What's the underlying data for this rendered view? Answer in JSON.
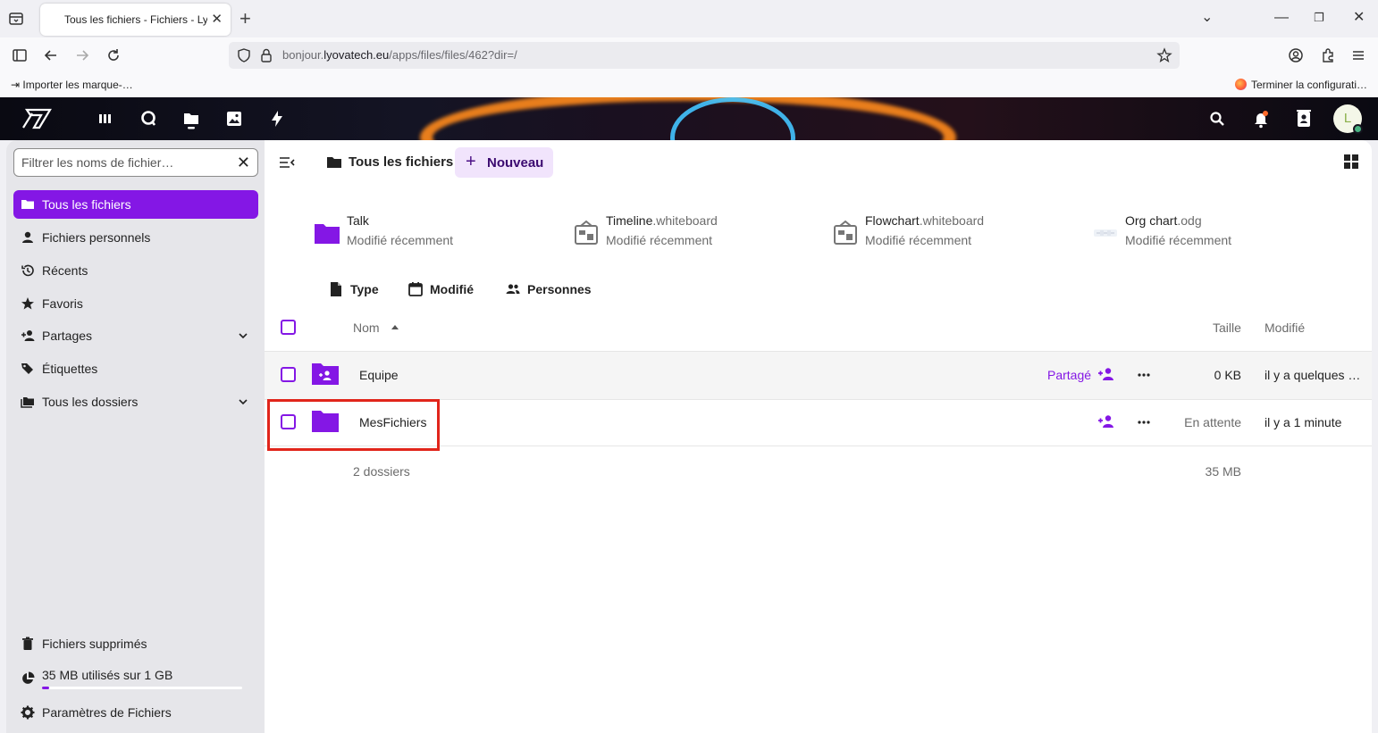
{
  "browser": {
    "tab_title": "Tous les fichiers - Fichiers - Lyov",
    "url_prefix": "bonjour.",
    "url_domain": "lyovatech.eu",
    "url_path": "/apps/files/files/462?dir=/",
    "bookmark_left": "Importer les marque-…",
    "bookmark_right": "Terminer la configurati…"
  },
  "sidebar": {
    "filter_placeholder": "Filtrer les noms de fichier…",
    "items": [
      {
        "label": "Tous les fichiers"
      },
      {
        "label": "Fichiers personnels"
      },
      {
        "label": "Récents"
      },
      {
        "label": "Favoris"
      },
      {
        "label": "Partages"
      },
      {
        "label": "Étiquettes"
      },
      {
        "label": "Tous les dossiers"
      }
    ],
    "footer": {
      "trash": "Fichiers supprimés",
      "quota": "35 MB utilisés sur 1 GB",
      "quota_fraction": 0.035,
      "settings": "Paramètres de Fichiers"
    }
  },
  "main": {
    "breadcrumb": "Tous les fichiers",
    "new_button": "Nouveau",
    "recent": [
      {
        "name": "Talk",
        "ext": "",
        "sub": "Modifié récemment"
      },
      {
        "name": "Timeline",
        "ext": ".whiteboard",
        "sub": "Modifié récemment"
      },
      {
        "name": "Flowchart",
        "ext": ".whiteboard",
        "sub": "Modifié récemment"
      },
      {
        "name": "Org chart",
        "ext": ".odg",
        "sub": "Modifié récemment"
      }
    ],
    "filters": {
      "type": "Type",
      "modified": "Modifié",
      "people": "Personnes"
    },
    "columns": {
      "name": "Nom",
      "size": "Taille",
      "modified": "Modifié"
    },
    "rows": [
      {
        "name": "Equipe",
        "share_label": "Partagé",
        "size": "0 KB",
        "modified": "il y a quelques …"
      },
      {
        "name": "MesFichiers",
        "share_label": "",
        "size": "En attente",
        "modified": "il y a 1 minute"
      }
    ],
    "summary": {
      "count": "2 dossiers",
      "size": "35 MB"
    }
  },
  "colors": {
    "accent": "#8417e5",
    "highlight": "#e1251b"
  }
}
